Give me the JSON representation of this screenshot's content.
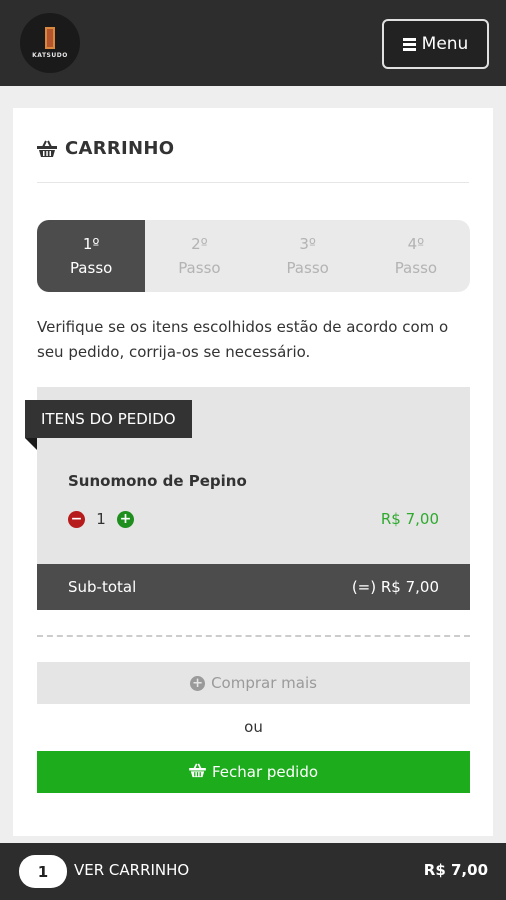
{
  "header": {
    "logo_text": "KATSUDO",
    "menu_label": "Menu"
  },
  "cart": {
    "title": "CARRINHO",
    "steps": [
      {
        "number": "1º",
        "label": "Passo",
        "active": true
      },
      {
        "number": "2º",
        "label": "Passo",
        "active": false
      },
      {
        "number": "3º",
        "label": "Passo",
        "active": false
      },
      {
        "number": "4º",
        "label": "Passo",
        "active": false
      }
    ],
    "instructions": "Verifique se os itens escolhidos estão de acordo com o seu pedido, corrija-os se necessário.",
    "order_section_label": "ITENS DO PEDIDO",
    "items": [
      {
        "name": "Sunomono de Pepino",
        "quantity": "1",
        "price": "R$ 7,00"
      }
    ],
    "subtotal_label": "Sub-total",
    "subtotal_value": "(=) R$ 7,00",
    "buy_more_label": "Comprar mais",
    "or_label": "ou",
    "checkout_label": "Fechar pedido"
  },
  "bottom_bar": {
    "count": "1",
    "label": "VER CARRINHO",
    "total": "R$ 7,00"
  },
  "colors": {
    "topbar": "#2d2d2d",
    "accent_green": "#1cac1c",
    "price_green": "#2eaa2e",
    "minus_red": "#b71c1c",
    "step_active": "#4c4c4c"
  }
}
